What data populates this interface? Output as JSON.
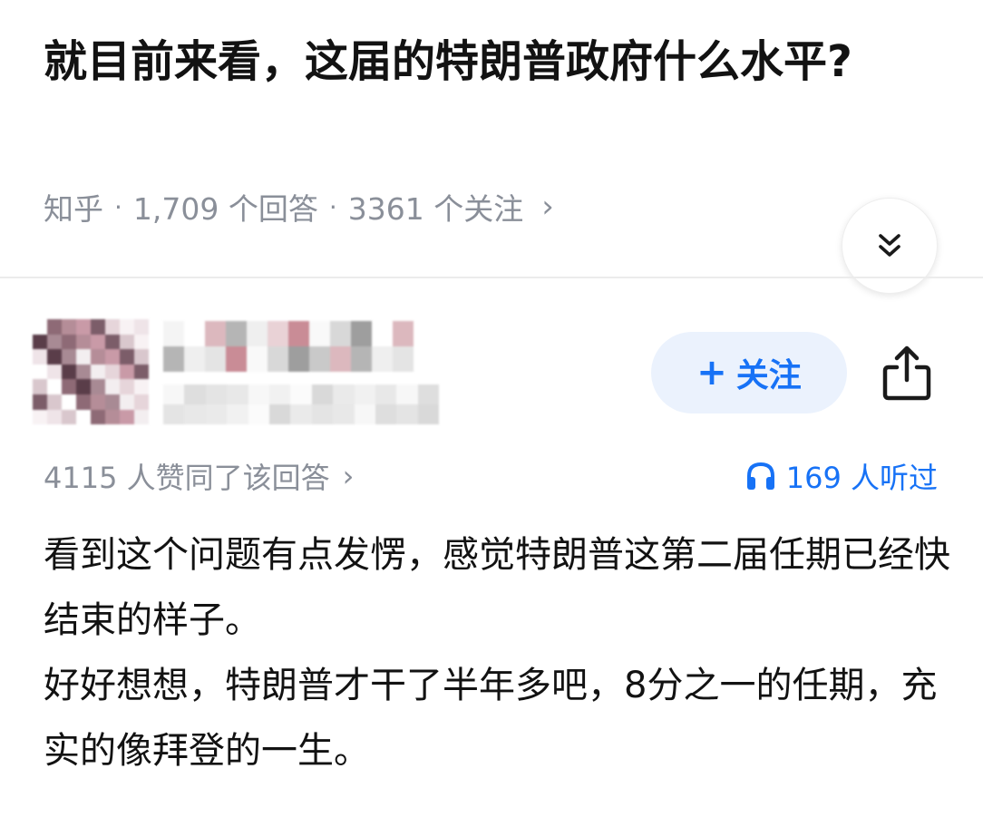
{
  "question": {
    "title": "就目前来看，这届的特朗普政府什么水平?"
  },
  "meta": {
    "site": "知乎",
    "separator": "·",
    "answers": "1,709 个回答",
    "followers": "3361 个关注",
    "chevron": "›"
  },
  "icons": {
    "collapse": "double-chevron-down-icon",
    "share": "share-icon",
    "headphones": "headphones-icon"
  },
  "colors": {
    "accent": "#1772f6",
    "follow_bg": "#ebf2fd",
    "muted_text": "#8a8f99",
    "title_text": "#121212"
  },
  "author": {
    "avatar_blurred": true,
    "name_blurred": true,
    "bio_blurred": true
  },
  "actions": {
    "follow_plus": "+",
    "follow_label": "关注"
  },
  "answer": {
    "upvotes": "4115 人赞同了该回答",
    "upvotes_chevron": "›",
    "listens": "169 人听过",
    "paragraphs": [
      "看到这个问题有点发愣，感觉特朗普这第二届任期已经快结束的样子。",
      "好好想想，特朗普才干了半年多吧，8分之一的任期，充实的像拜登的一生。"
    ]
  }
}
